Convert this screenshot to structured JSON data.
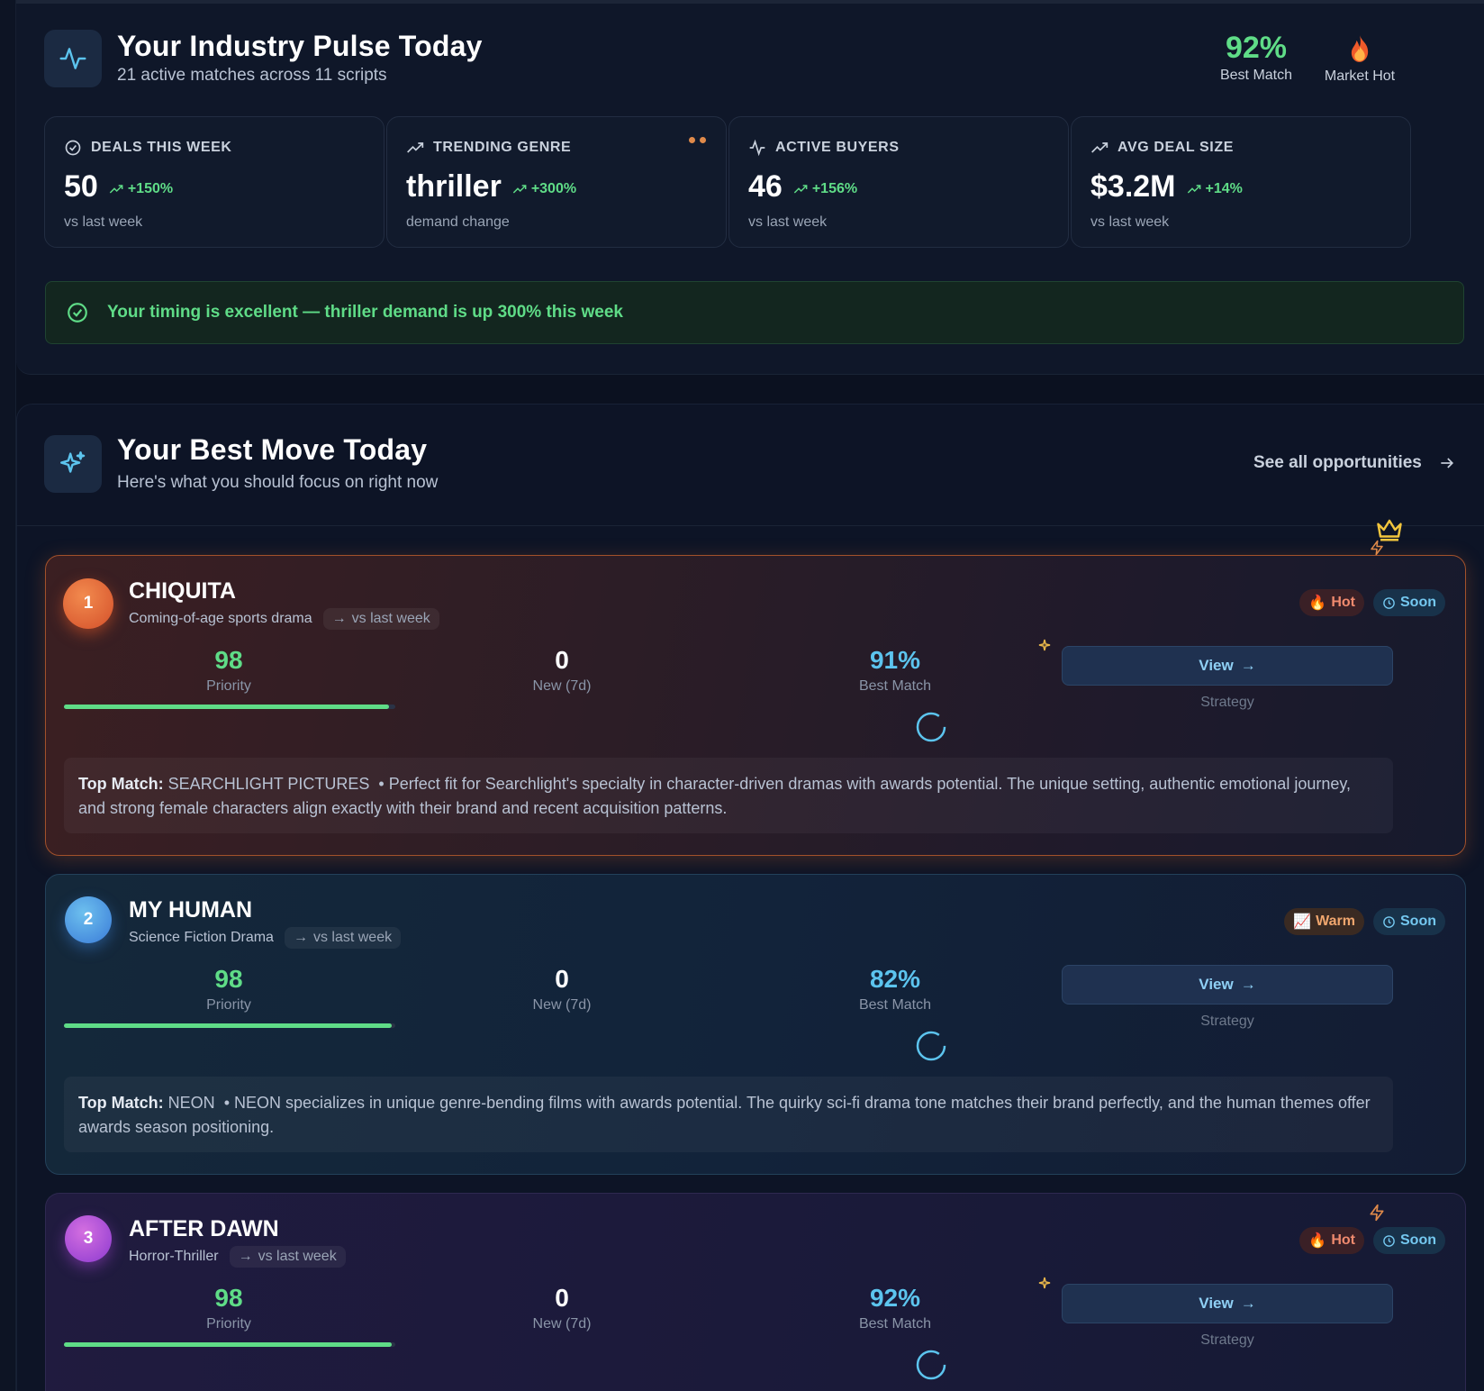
{
  "pulse": {
    "title": "Your Industry Pulse Today",
    "subtitle": "21 active matches across 11 scripts",
    "best_match_value": "92%",
    "best_match_label": "Best Match",
    "market_hot_label": "Market Hot",
    "icon": "activity-pulse-icon"
  },
  "stats": [
    {
      "label": "DEALS THIS WEEK",
      "value": "50",
      "change": "+150%",
      "note": "vs last week",
      "icon": "check-circle-icon"
    },
    {
      "label": "TRENDING GENRE",
      "value": "thriller",
      "change": "+300%",
      "note": "demand change",
      "icon": "trending-up-icon"
    },
    {
      "label": "ACTIVE BUYERS",
      "value": "46",
      "change": "+156%",
      "note": "vs last week",
      "icon": "activity-icon"
    },
    {
      "label": "AVG DEAL SIZE",
      "value": "$3.2M",
      "change": "+14%",
      "note": "vs last week",
      "icon": "trending-up-icon"
    }
  ],
  "timing_message": "Your timing is excellent — thriller demand is up 300% this week",
  "best_move": {
    "title": "Your Best Move Today",
    "subtitle": "Here's what you should focus on right now",
    "see_all": "See all opportunities"
  },
  "cards": [
    {
      "rank": "1",
      "title": "CHIQUITA",
      "genre": "Coming-of-age sports drama",
      "vs": "vs last week",
      "badge_heat": "Hot",
      "badge_heat_icon": "🔥",
      "badge_time": "Soon",
      "priority": "98",
      "priority_label": "Priority",
      "priority_pct": 98,
      "new": "0",
      "new_label": "New (7d)",
      "best": "91%",
      "best_label": "Best Match",
      "view": "View",
      "strategy": "Strategy",
      "top_match_label": "Top Match:",
      "top_match": "SEARCHLIGHT PICTURES",
      "reason": "Perfect fit for Searchlight's specialty in character-driven dramas with awards potential. The unique setting, authentic emotional journey, and strong female characters align exactly with their brand and recent acquisition patterns."
    },
    {
      "rank": "2",
      "title": "MY HUMAN",
      "genre": "Science Fiction Drama",
      "vs": "vs last week",
      "badge_heat": "Warm",
      "badge_heat_icon": "📈",
      "badge_time": "Soon",
      "priority": "98",
      "priority_label": "Priority",
      "priority_pct": 99,
      "new": "0",
      "new_label": "New (7d)",
      "best": "82%",
      "best_label": "Best Match",
      "view": "View",
      "strategy": "Strategy",
      "top_match_label": "Top Match:",
      "top_match": "NEON",
      "reason": "NEON specializes in unique genre-bending films with awards potential. The quirky sci-fi drama tone matches their brand perfectly, and the human themes offer awards season positioning."
    },
    {
      "rank": "3",
      "title": "AFTER DAWN",
      "genre": "Horror-Thriller",
      "vs": "vs last week",
      "badge_heat": "Hot",
      "badge_heat_icon": "🔥",
      "badge_time": "Soon",
      "priority": "98",
      "priority_label": "Priority",
      "priority_pct": 99,
      "new": "0",
      "new_label": "New (7d)",
      "best": "92%",
      "best_label": "Best Match",
      "view": "View",
      "strategy": "Strategy"
    }
  ],
  "colors": {
    "green": "#5fdc87",
    "cyan": "#5cc4ee",
    "orange_accent": "#e08a4a",
    "background": "#0b1120"
  }
}
